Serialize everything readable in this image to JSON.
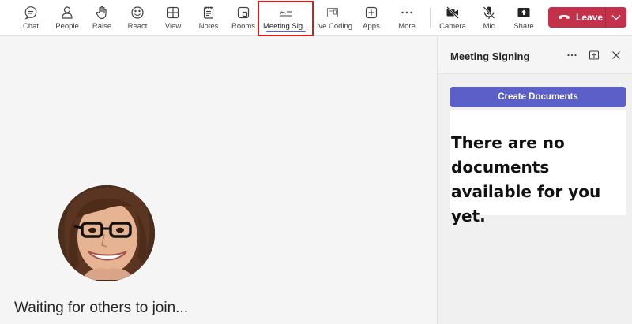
{
  "toolbar": {
    "items": [
      {
        "label": "Chat",
        "icon": "chat-icon"
      },
      {
        "label": "People",
        "icon": "people-icon"
      },
      {
        "label": "Raise",
        "icon": "raise-hand-icon"
      },
      {
        "label": "React",
        "icon": "react-icon"
      },
      {
        "label": "View",
        "icon": "view-icon"
      },
      {
        "label": "Notes",
        "icon": "notes-icon"
      },
      {
        "label": "Rooms",
        "icon": "rooms-icon"
      },
      {
        "label": "Meeting Sig...",
        "icon": "meeting-signing-icon"
      },
      {
        "label": "Live Coding",
        "icon": "live-coding-icon"
      },
      {
        "label": "Apps",
        "icon": "apps-icon"
      },
      {
        "label": "More",
        "icon": "more-icon"
      },
      {
        "label": "Camera",
        "icon": "camera-off-icon"
      },
      {
        "label": "Mic",
        "icon": "mic-off-icon"
      },
      {
        "label": "Share",
        "icon": "share-icon"
      }
    ],
    "leave": {
      "label": "Leave",
      "color": "#c4314b"
    },
    "active_item": "Meeting Sig...",
    "highlight_color": "#e01818"
  },
  "stage": {
    "waiting_text": "Waiting for others to join..."
  },
  "panel": {
    "title": "Meeting Signing",
    "create_button": "Create Documents",
    "empty_message": "There are no documents available for you yet.",
    "accent": "#5b5fc7"
  }
}
